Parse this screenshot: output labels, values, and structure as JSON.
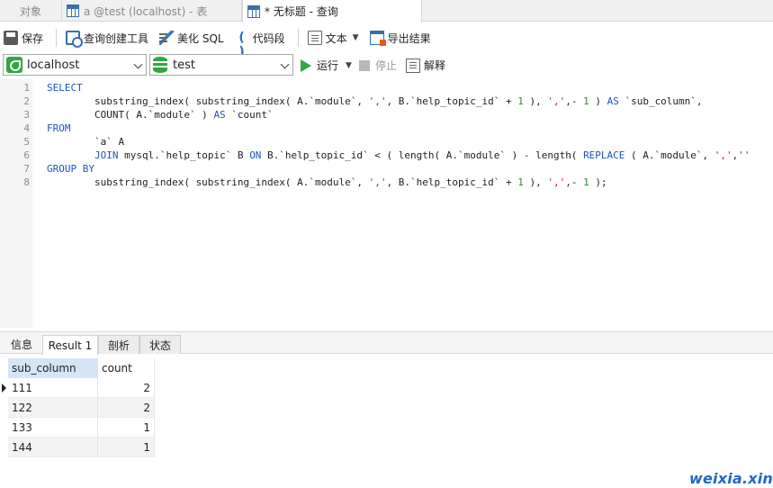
{
  "tabs": [
    {
      "label": "对象"
    },
    {
      "label": "a @test (localhost) - 表"
    },
    {
      "label": "* 无标题 - 查询"
    }
  ],
  "toolbar": {
    "save": "保存",
    "query_builder": "查询创建工具",
    "beautify": "美化 SQL",
    "snippet": "代码段",
    "text": "文本",
    "export": "导出结果"
  },
  "connection": {
    "host": "localhost",
    "database": "test",
    "run": "运行",
    "stop": "停止",
    "explain": "解释"
  },
  "editor": {
    "line_numbers": [
      "1",
      "2",
      "3",
      "4",
      "5",
      "6",
      "7",
      "8"
    ],
    "lines": [
      [
        {
          "t": "SELECT",
          "c": "#1a53c4"
        }
      ],
      [
        {
          "t": "        substring_index( substring_index( A.`module`, ",
          "c": "#1e1e1e"
        },
        {
          "t": "','",
          "c": "#c2185b"
        },
        {
          "t": ", B.`help_topic_id` + ",
          "c": "#1e1e1e"
        },
        {
          "t": "1",
          "c": "#2e8b2e"
        },
        {
          "t": " ), ",
          "c": "#1e1e1e"
        },
        {
          "t": "','",
          "c": "#c2185b"
        },
        {
          "t": ",- ",
          "c": "#1e1e1e"
        },
        {
          "t": "1",
          "c": "#2e8b2e"
        },
        {
          "t": " ) ",
          "c": "#1e1e1e"
        },
        {
          "t": "AS",
          "c": "#1a53c4"
        },
        {
          "t": " `sub_column`,",
          "c": "#1e1e1e"
        }
      ],
      [
        {
          "t": "        COUNT( A.`module` ) ",
          "c": "#1e1e1e"
        },
        {
          "t": "AS",
          "c": "#1a53c4"
        },
        {
          "t": " `count`",
          "c": "#1e1e1e"
        }
      ],
      [
        {
          "t": "FROM",
          "c": "#1a53c4"
        }
      ],
      [
        {
          "t": "        `a` A",
          "c": "#1e1e1e"
        }
      ],
      [
        {
          "t": "        ",
          "c": "#1e1e1e"
        },
        {
          "t": "JOIN",
          "c": "#1a53c4"
        },
        {
          "t": " mysql.`help_topic` B ",
          "c": "#1e1e1e"
        },
        {
          "t": "ON",
          "c": "#1a53c4"
        },
        {
          "t": " B.`help_topic_id` < ( length( A.`module` ) - length( ",
          "c": "#1e1e1e"
        },
        {
          "t": "REPLACE",
          "c": "#1a53c4"
        },
        {
          "t": " ( A.`module`, ",
          "c": "#1e1e1e"
        },
        {
          "t": "','",
          "c": "#c2185b"
        },
        {
          "t": ",",
          "c": "#1e1e1e"
        },
        {
          "t": "''",
          "c": "#c2185b"
        }
      ],
      [
        {
          "t": "GROUP BY",
          "c": "#1a53c4"
        }
      ],
      [
        {
          "t": "        substring_index( substring_index( A.`module`, ",
          "c": "#1e1e1e"
        },
        {
          "t": "','",
          "c": "#c2185b"
        },
        {
          "t": ", B.`help_topic_id` + ",
          "c": "#1e1e1e"
        },
        {
          "t": "1",
          "c": "#2e8b2e"
        },
        {
          "t": " ), ",
          "c": "#1e1e1e"
        },
        {
          "t": "','",
          "c": "#c2185b"
        },
        {
          "t": ",- ",
          "c": "#1e1e1e"
        },
        {
          "t": "1",
          "c": "#2e8b2e"
        },
        {
          "t": " );",
          "c": "#1e1e1e"
        }
      ]
    ]
  },
  "result_tabs": [
    "信息",
    "Result 1",
    "剖析",
    "状态"
  ],
  "grid": {
    "columns": [
      "sub_column",
      "count"
    ],
    "rows": [
      [
        "111",
        "2"
      ],
      [
        "122",
        "2"
      ],
      [
        "133",
        "1"
      ],
      [
        "144",
        "1"
      ]
    ]
  },
  "watermark": "weixia.xin",
  "colors": {
    "keyword": "#1a53c4",
    "string": "#c2185b",
    "number": "#2e8b2e",
    "accent_green": "#2fa842",
    "selected_header": "#d3e5f6"
  }
}
